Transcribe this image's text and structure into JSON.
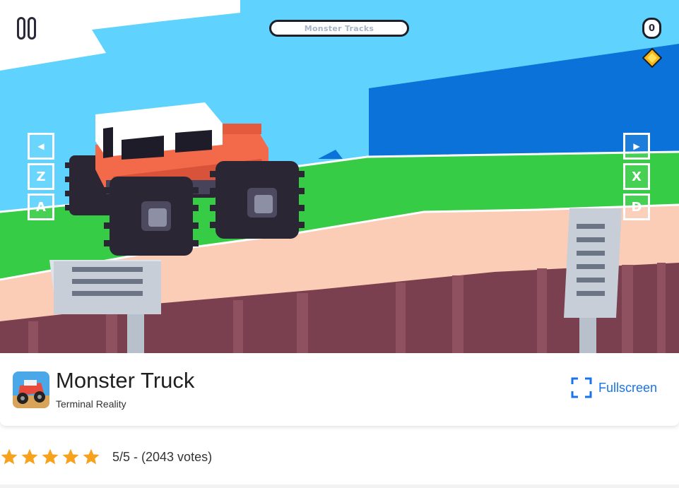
{
  "game": {
    "hud_title": "Monster Tracks",
    "score": "0",
    "controls_left": [
      "◀",
      "Z",
      "A"
    ],
    "controls_right": [
      "▶",
      "X",
      "D"
    ]
  },
  "info": {
    "title": "Monster Truck",
    "developer": "Terminal Reality",
    "fullscreen_label": "Fullscreen"
  },
  "rating": {
    "stars": 5,
    "text": "5/5 - (2043 votes)"
  },
  "colors": {
    "sky": "#5fd3fd",
    "grass": "#37cc46",
    "road": "#fbcdb6",
    "dirt": "#7b4050",
    "truck_body": "#f26a4a",
    "accent": "#1a73e8",
    "star": "#f6a21d"
  }
}
